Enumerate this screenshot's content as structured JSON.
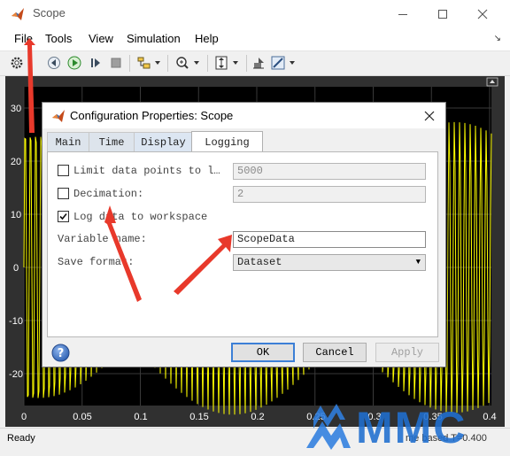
{
  "window": {
    "title": "Scope",
    "controls": {
      "minimize": "minimize",
      "maximize": "maximize",
      "close": "close"
    }
  },
  "menu": {
    "items": [
      "File",
      "Tools",
      "View",
      "Simulation",
      "Help"
    ]
  },
  "toolbar": {
    "icons": [
      "gear-icon",
      "step-back-icon",
      "run-icon",
      "step-forward-icon",
      "stop-icon",
      "highlight-icon",
      "zoom-icon",
      "scale-icon",
      "style-icon",
      "measure-icon"
    ]
  },
  "axes": {
    "y_ticks": [
      "30",
      "20",
      "10",
      "0",
      "-10",
      "-20"
    ],
    "x_ticks": [
      "0",
      "0.05",
      "0.1",
      "0.15",
      "0.2",
      "0.25",
      "0.3",
      "0.35",
      "0.4"
    ],
    "background": "#000000",
    "signal_color": "#ffff00"
  },
  "status": {
    "left": "Ready",
    "right": "me based  T=0.400"
  },
  "dialog": {
    "title": "Configuration Properties: Scope",
    "tabs": [
      "Main",
      "Time",
      "Display",
      "Logging"
    ],
    "active_tab": "Logging",
    "limit_data_points": {
      "label": "Limit data points to l…",
      "checked": false,
      "value": "5000"
    },
    "decimation": {
      "label": "Decimation:",
      "checked": false,
      "value": "2"
    },
    "log_data": {
      "label": "Log data to workspace",
      "checked": true
    },
    "variable_name": {
      "label": "Variable name:",
      "value": "ScopeData"
    },
    "save_format": {
      "label": "Save format:",
      "value": "Dataset"
    },
    "buttons": {
      "ok": "OK",
      "cancel": "Cancel",
      "apply": "Apply"
    }
  },
  "watermark": {
    "text": "MMC",
    "color": "#1f6fd0"
  },
  "annotation_color": "#e8392b"
}
